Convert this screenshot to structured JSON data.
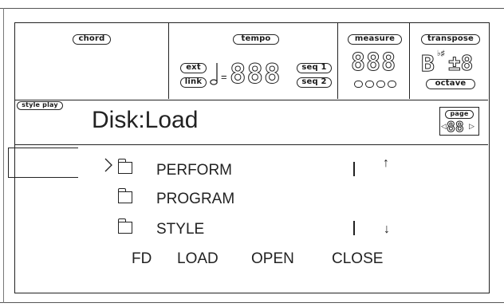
{
  "top": {
    "chord_label": "chord",
    "tempo_label": "tempo",
    "ext_label": "ext",
    "link_label": "link",
    "seq1_label": "seq 1",
    "seq2_label": "seq 2",
    "tempo_value": "888",
    "measure_label": "measure",
    "measure_value": "888",
    "transpose_label": "transpose",
    "transpose_note": "B",
    "transpose_accidental": "♭♯",
    "transpose_value": "±8",
    "octave_label": "octave"
  },
  "mode": {
    "style_play_label": "style play",
    "page_title": "Disk:Load",
    "page_label": "page",
    "page_value": "88"
  },
  "file_list": [
    {
      "name": "PERFORM",
      "scroll": "up-arrow"
    },
    {
      "name": "PROGRAM",
      "scroll": ""
    },
    {
      "name": "STYLE",
      "scroll": "down-arrow"
    }
  ],
  "bottom_menu": {
    "fd": "FD",
    "load": "LOAD",
    "open": "OPEN",
    "close": "CLOSE"
  }
}
